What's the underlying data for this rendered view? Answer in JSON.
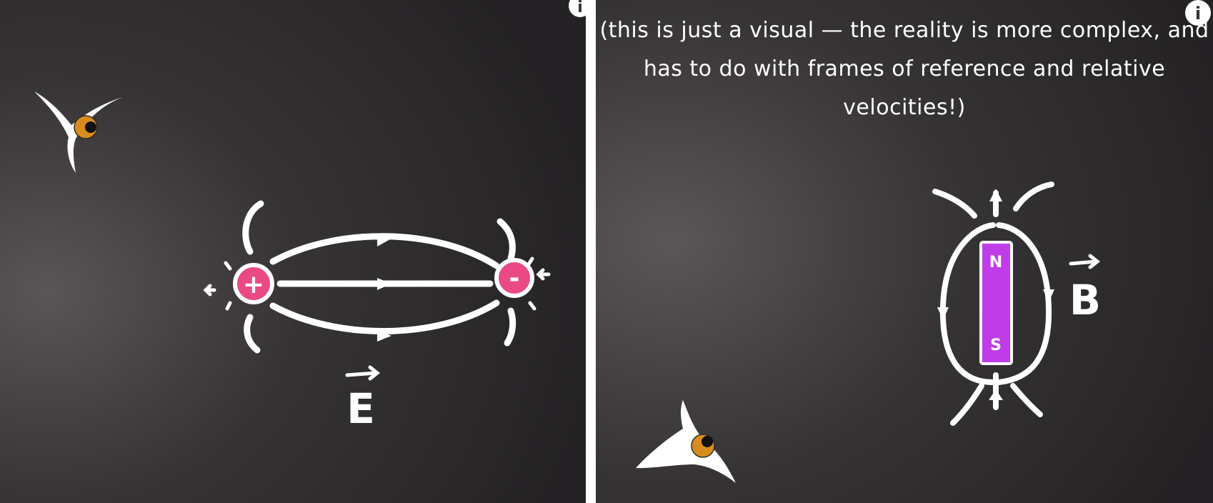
{
  "left_panel": {
    "field_label": "E",
    "positive_charge_symbol": "+",
    "negative_charge_symbol": "-",
    "charge_color": "#e94a86",
    "info_icon_symbol": "i",
    "icons": [
      "eye-icon",
      "info-icon"
    ]
  },
  "right_panel": {
    "caption_line1": "(this is just a visual — the reality is more complex, and",
    "caption_line2": "has to do with frames of reference and relative velocities!)",
    "field_label": "B",
    "magnet_north": "N",
    "magnet_south": "S",
    "magnet_color": "#c03ce8",
    "info_icon_symbol": "i",
    "icons": [
      "eye-icon",
      "info-icon"
    ]
  },
  "colors": {
    "chalkboard": "#2e2c2e",
    "chalk": "#ffffff",
    "divider": "#ffffff",
    "iris": "#d98c1e"
  }
}
